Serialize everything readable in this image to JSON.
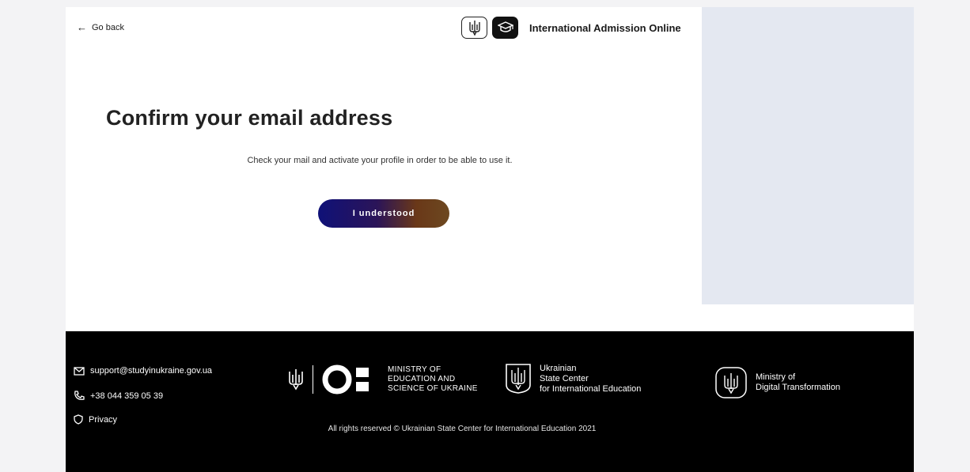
{
  "header": {
    "back_label": "Go back",
    "brand_title": "International Admission Online"
  },
  "main": {
    "title": "Confirm your email address",
    "subtitle": "Check your mail and activate your profile in order to be able to use it.",
    "button_label": "I understood"
  },
  "footer": {
    "email": "support@studyinukraine.gov.ua",
    "phone": "+38 044 359 05 39",
    "privacy_label": "Privacy",
    "ministry_education": [
      "MINISTRY OF",
      "EDUCATION AND",
      "SCIENCE OF UKRAINE"
    ],
    "state_center": [
      "Ukrainian",
      "State Center",
      "for International Education"
    ],
    "digital_ministry": [
      "Ministry of",
      "Digital Transformation"
    ],
    "rights": "All rights reserved © Ukrainian State Center for International Education 2021"
  },
  "colors": {
    "side_panel": "#e4e8f1",
    "footer_bg": "#000000",
    "button_gradient_start": "#0f1178",
    "button_gradient_end": "#6c4820"
  },
  "icons": [
    "arrow-left-icon",
    "trident-icon",
    "graduation-cap-icon",
    "mail-icon",
    "phone-icon",
    "shield-icon",
    "mon-logo-icon"
  ]
}
